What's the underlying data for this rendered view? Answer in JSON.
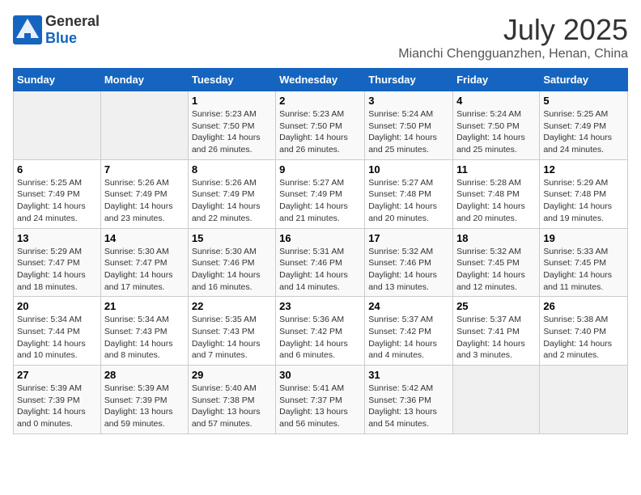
{
  "header": {
    "logo_general": "General",
    "logo_blue": "Blue",
    "month_year": "July 2025",
    "location": "Mianchi Chengguanzhen, Henan, China"
  },
  "columns": [
    "Sunday",
    "Monday",
    "Tuesday",
    "Wednesday",
    "Thursday",
    "Friday",
    "Saturday"
  ],
  "weeks": [
    [
      {
        "day": "",
        "info": ""
      },
      {
        "day": "",
        "info": ""
      },
      {
        "day": "1",
        "info": "Sunrise: 5:23 AM\nSunset: 7:50 PM\nDaylight: 14 hours and 26 minutes."
      },
      {
        "day": "2",
        "info": "Sunrise: 5:23 AM\nSunset: 7:50 PM\nDaylight: 14 hours and 26 minutes."
      },
      {
        "day": "3",
        "info": "Sunrise: 5:24 AM\nSunset: 7:50 PM\nDaylight: 14 hours and 25 minutes."
      },
      {
        "day": "4",
        "info": "Sunrise: 5:24 AM\nSunset: 7:50 PM\nDaylight: 14 hours and 25 minutes."
      },
      {
        "day": "5",
        "info": "Sunrise: 5:25 AM\nSunset: 7:49 PM\nDaylight: 14 hours and 24 minutes."
      }
    ],
    [
      {
        "day": "6",
        "info": "Sunrise: 5:25 AM\nSunset: 7:49 PM\nDaylight: 14 hours and 24 minutes."
      },
      {
        "day": "7",
        "info": "Sunrise: 5:26 AM\nSunset: 7:49 PM\nDaylight: 14 hours and 23 minutes."
      },
      {
        "day": "8",
        "info": "Sunrise: 5:26 AM\nSunset: 7:49 PM\nDaylight: 14 hours and 22 minutes."
      },
      {
        "day": "9",
        "info": "Sunrise: 5:27 AM\nSunset: 7:49 PM\nDaylight: 14 hours and 21 minutes."
      },
      {
        "day": "10",
        "info": "Sunrise: 5:27 AM\nSunset: 7:48 PM\nDaylight: 14 hours and 20 minutes."
      },
      {
        "day": "11",
        "info": "Sunrise: 5:28 AM\nSunset: 7:48 PM\nDaylight: 14 hours and 20 minutes."
      },
      {
        "day": "12",
        "info": "Sunrise: 5:29 AM\nSunset: 7:48 PM\nDaylight: 14 hours and 19 minutes."
      }
    ],
    [
      {
        "day": "13",
        "info": "Sunrise: 5:29 AM\nSunset: 7:47 PM\nDaylight: 14 hours and 18 minutes."
      },
      {
        "day": "14",
        "info": "Sunrise: 5:30 AM\nSunset: 7:47 PM\nDaylight: 14 hours and 17 minutes."
      },
      {
        "day": "15",
        "info": "Sunrise: 5:30 AM\nSunset: 7:46 PM\nDaylight: 14 hours and 16 minutes."
      },
      {
        "day": "16",
        "info": "Sunrise: 5:31 AM\nSunset: 7:46 PM\nDaylight: 14 hours and 14 minutes."
      },
      {
        "day": "17",
        "info": "Sunrise: 5:32 AM\nSunset: 7:46 PM\nDaylight: 14 hours and 13 minutes."
      },
      {
        "day": "18",
        "info": "Sunrise: 5:32 AM\nSunset: 7:45 PM\nDaylight: 14 hours and 12 minutes."
      },
      {
        "day": "19",
        "info": "Sunrise: 5:33 AM\nSunset: 7:45 PM\nDaylight: 14 hours and 11 minutes."
      }
    ],
    [
      {
        "day": "20",
        "info": "Sunrise: 5:34 AM\nSunset: 7:44 PM\nDaylight: 14 hours and 10 minutes."
      },
      {
        "day": "21",
        "info": "Sunrise: 5:34 AM\nSunset: 7:43 PM\nDaylight: 14 hours and 8 minutes."
      },
      {
        "day": "22",
        "info": "Sunrise: 5:35 AM\nSunset: 7:43 PM\nDaylight: 14 hours and 7 minutes."
      },
      {
        "day": "23",
        "info": "Sunrise: 5:36 AM\nSunset: 7:42 PM\nDaylight: 14 hours and 6 minutes."
      },
      {
        "day": "24",
        "info": "Sunrise: 5:37 AM\nSunset: 7:42 PM\nDaylight: 14 hours and 4 minutes."
      },
      {
        "day": "25",
        "info": "Sunrise: 5:37 AM\nSunset: 7:41 PM\nDaylight: 14 hours and 3 minutes."
      },
      {
        "day": "26",
        "info": "Sunrise: 5:38 AM\nSunset: 7:40 PM\nDaylight: 14 hours and 2 minutes."
      }
    ],
    [
      {
        "day": "27",
        "info": "Sunrise: 5:39 AM\nSunset: 7:39 PM\nDaylight: 14 hours and 0 minutes."
      },
      {
        "day": "28",
        "info": "Sunrise: 5:39 AM\nSunset: 7:39 PM\nDaylight: 13 hours and 59 minutes."
      },
      {
        "day": "29",
        "info": "Sunrise: 5:40 AM\nSunset: 7:38 PM\nDaylight: 13 hours and 57 minutes."
      },
      {
        "day": "30",
        "info": "Sunrise: 5:41 AM\nSunset: 7:37 PM\nDaylight: 13 hours and 56 minutes."
      },
      {
        "day": "31",
        "info": "Sunrise: 5:42 AM\nSunset: 7:36 PM\nDaylight: 13 hours and 54 minutes."
      },
      {
        "day": "",
        "info": ""
      },
      {
        "day": "",
        "info": ""
      }
    ]
  ]
}
